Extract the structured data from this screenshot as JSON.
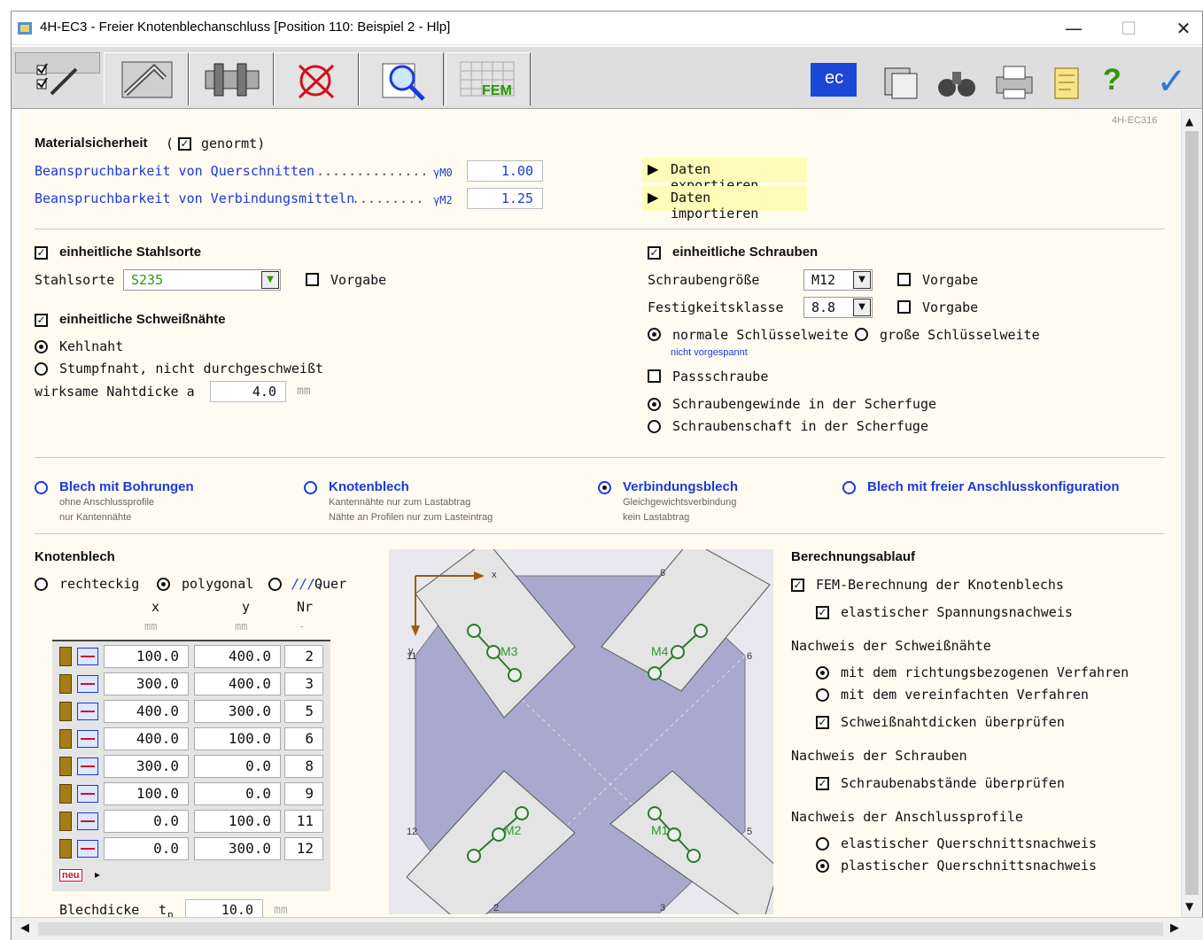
{
  "window": {
    "title": "4H-EC3 - Freier Knotenblechanschluss [Position 110: Beispiel 2 - Hlp]",
    "minimize": "—",
    "maximize": "☐",
    "close": "✕"
  },
  "toolbar": {
    "tabs": [
      "check-edit-icon",
      "graph-icon",
      "bolts-icon",
      "no-load-icon",
      "magnifier-icon",
      "fem-grid-icon"
    ],
    "fem_label": "FEM",
    "ec_label": "ec",
    "right_icons": [
      "ec-flag-icon",
      "copy-icon",
      "binoculars-icon",
      "printer-icon",
      "notes-icon",
      "help-icon",
      "confirm-check-icon"
    ],
    "help": "?",
    "ok": "✓"
  },
  "version_tag": "4H-EC316",
  "material": {
    "title": "Materialsicherheit",
    "paren_open": "(",
    "genormt": "genormt)",
    "row1_label": "Beanspruchbarkeit von Querschnitten",
    "row1_dots": "..............",
    "row1_sym": "γM0",
    "row1_value": "1.00",
    "row2_label": "Beanspruchbarkeit von Verbindungsmitteln",
    "row2_dots": ".........",
    "row2_sym": "γM2",
    "row2_value": "1.25",
    "export": "Daten exportieren",
    "import": "Daten importieren"
  },
  "steel": {
    "uniform_label": "einheitliche Stahlsorte",
    "label": "Stahlsorte",
    "value": "S235",
    "vorgabe": "Vorgabe"
  },
  "weld": {
    "uniform_label": "einheitliche Schweißnähte",
    "kehlnaht": "Kehlnaht",
    "stumpf": "Stumpfnaht, nicht durchgeschweißt",
    "thickness_label": "wirksame Nahtdicke  a",
    "thickness_value": "4.0",
    "unit": "mm"
  },
  "bolts": {
    "uniform_label": "einheitliche Schrauben",
    "size_label": "Schraubengröße",
    "size_value": "M12",
    "class_label": "Festigkeitsklasse",
    "class_value": "8.8",
    "vorgabe1": "Vorgabe",
    "vorgabe2": "Vorgabe",
    "normal_key": "normale Schlüsselweite",
    "large_key": "große Schlüsselweite",
    "not_preloaded": "nicht vorgespannt",
    "fit_bolt": "Passschraube",
    "thread": "Schraubengewinde in der Scherfuge",
    "shaft": "Schraubenschaft in der Scherfuge"
  },
  "plate_types": [
    {
      "title": "Blech mit Bohrungen",
      "line1": "ohne Anschlussprofile",
      "line2": "nur Kantennähte"
    },
    {
      "title": "Knotenblech",
      "line1": "Kantennähte nur zum Lastabtrag",
      "line2": "Nähte an Profilen nur zum Lasteintrag"
    },
    {
      "title": "Verbindungsblech",
      "line1": "Gleichgewichtsverbindung",
      "line2": "kein Lastabtrag"
    },
    {
      "title": "Blech mit freier Anschlusskonfiguration",
      "line1": "",
      "line2": ""
    }
  ],
  "knotenblech": {
    "title": "Knotenblech",
    "rect": "rechteckig",
    "poly": "polygonal",
    "quer": "Quer",
    "col_x": "x",
    "col_y": "y",
    "col_nr": "Nr",
    "unit_x": "mm",
    "unit_y": "mm",
    "unit_nr": "-",
    "rows": [
      [
        "100.0",
        "400.0",
        "2"
      ],
      [
        "300.0",
        "400.0",
        "3"
      ],
      [
        "400.0",
        "300.0",
        "5"
      ],
      [
        "400.0",
        "100.0",
        "6"
      ],
      [
        "300.0",
        "0.0",
        "8"
      ],
      [
        "100.0",
        "0.0",
        "9"
      ],
      [
        "0.0",
        "100.0",
        "11"
      ],
      [
        "0.0",
        "300.0",
        "12"
      ]
    ],
    "new_label": "neu",
    "thickness_label": "Blechdicke",
    "thickness_sym": "t",
    "thickness_sub": "p",
    "thickness_value": "10.0",
    "thickness_unit": "mm"
  },
  "drawing": {
    "axis_x": "x",
    "axis_y": "y",
    "bolts": [
      "M3",
      "M4",
      "M2",
      "M1"
    ],
    "nodes": [
      "8",
      "6",
      "5",
      "3",
      "2",
      "12",
      "11"
    ]
  },
  "calc": {
    "title": "Berechnungsablauf",
    "fem": "FEM-Berechnung der Knotenblechs",
    "elastic_stress": "elastischer Spannungsnachweis",
    "weld_title": "Nachweis der Schweißnähte",
    "directional": "mit dem richtungsbezogenen Verfahren",
    "simplified": "mit dem vereinfachten Verfahren",
    "weld_check": "Schweißnahtdicken überprüfen",
    "bolt_title": "Nachweis der Schrauben",
    "bolt_spacing": "Schraubenabstände überprüfen",
    "profile_title": "Nachweis der Anschlussprofile",
    "elastic_cs": "elastischer Querschnittsnachweis",
    "plastic_cs": "plastischer Querschnittsnachweis"
  },
  "colors": {
    "link_blue": "#1a3adb",
    "plate_fill": "#a9a9cf",
    "member_fill": "#e4e4e4",
    "background": "#fffbf0",
    "highlight": "#fffbb8"
  }
}
